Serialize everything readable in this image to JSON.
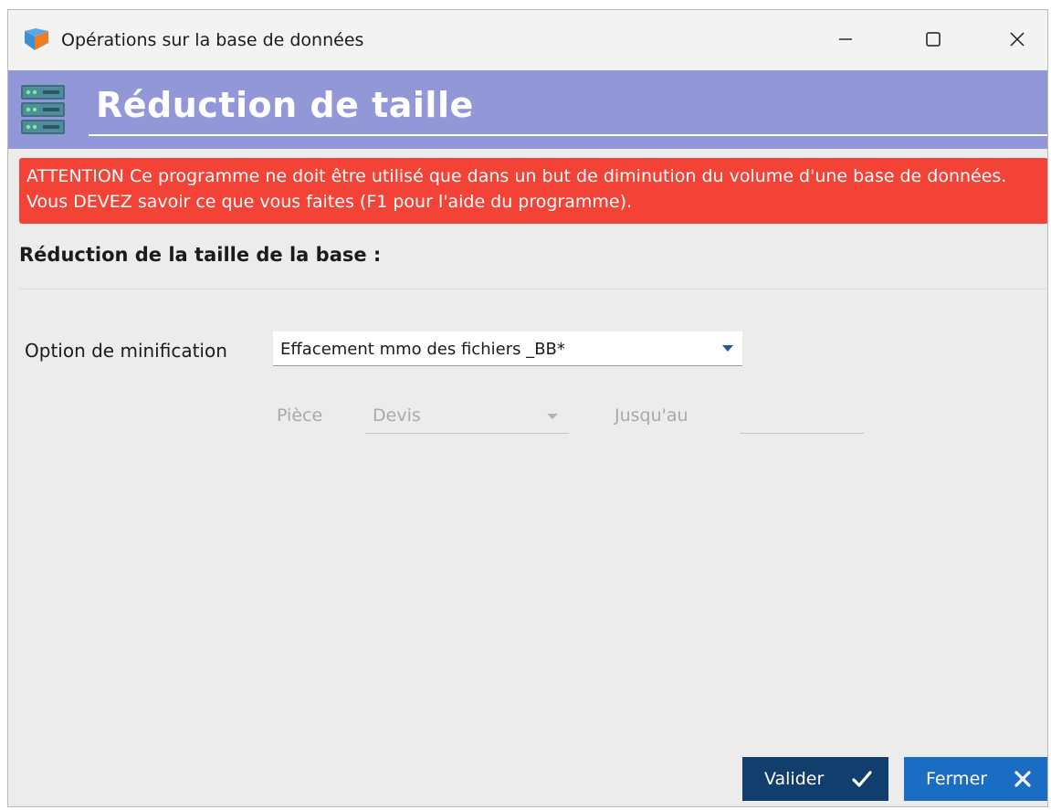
{
  "window": {
    "title": "Opérations sur la base de données"
  },
  "header": {
    "title": "Réduction de taille",
    "icon": "server-stack-icon",
    "accent": "#9297d8"
  },
  "warning": {
    "text": "ATTENTION Ce programme ne doit être utilisé que dans un but de diminution du volume d'une base de données. Vous DEVEZ savoir ce que vous faites (F1 pour l'aide du programme).",
    "color": "#f34236"
  },
  "section": {
    "title": "Réduction de la taille de la base :"
  },
  "form": {
    "minification_label": "Option de minification",
    "minification_value": "Effacement mmo des fichiers _BB*",
    "piece_label": "Pièce",
    "piece_value": "Devis",
    "jusquau_label": "Jusqu'au",
    "jusquau_value": ""
  },
  "buttons": {
    "valider": "Valider",
    "fermer": "Fermer",
    "valider_color": "#123e6e",
    "fermer_color": "#1b6cc3"
  }
}
